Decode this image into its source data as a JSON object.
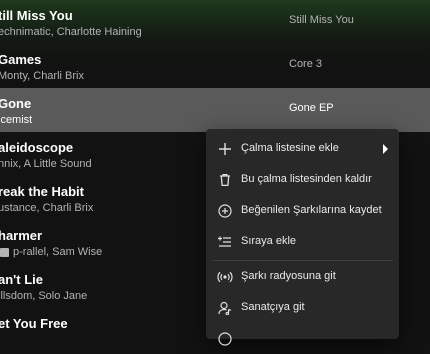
{
  "tracks": [
    {
      "title": "till Miss You",
      "artists": "echnimatic, Charlotte Haining",
      "album": "Still Miss You",
      "explicit": false,
      "selected": false
    },
    {
      "title": "Games",
      "artists": "Monty, Charli Brix",
      "album": "Core 3",
      "explicit": false,
      "selected": false
    },
    {
      "title": "Gone",
      "artists": "lcemist",
      "album": "Gone EP",
      "explicit": false,
      "selected": true
    },
    {
      "title": "aleidoscope",
      "artists": "nnix, A Little Sound",
      "album": "",
      "explicit": false,
      "selected": false
    },
    {
      "title": "reak the Habit",
      "artists": "ustance, Charli Brix",
      "album": "",
      "explicit": false,
      "selected": false
    },
    {
      "title": "harmer",
      "artists": "p-rallel, Sam Wise",
      "album": "",
      "explicit": true,
      "selected": false
    },
    {
      "title": "an't Lie",
      "artists": "illsdom, Solo Jane",
      "album": "",
      "explicit": false,
      "selected": false
    },
    {
      "title": "et You Free",
      "artists": "",
      "album": "",
      "explicit": false,
      "selected": false
    }
  ],
  "context_menu": {
    "items": [
      {
        "label": "Çalma listesine ekle",
        "icon": "plus-icon",
        "has_submenu": true
      },
      {
        "label": "Bu çalma listesinden kaldır",
        "icon": "trash-icon",
        "has_submenu": false
      },
      {
        "label": "Beğenilen Şarkılarına kaydet",
        "icon": "add-circle-icon",
        "has_submenu": false
      },
      {
        "label": "Sıraya ekle",
        "icon": "queue-icon",
        "has_submenu": false
      },
      {
        "label": "Şarkı radyosuna git",
        "icon": "radio-icon",
        "has_submenu": false
      },
      {
        "label": "Sanatçıya git",
        "icon": "artist-icon",
        "has_submenu": false
      }
    ]
  },
  "colors": {
    "background": "#121212",
    "header_gradient": "#1f3a1c",
    "selected_row": "#5a5a5a",
    "menu_background": "#282828",
    "text_primary": "#ffffff",
    "text_secondary": "#b3b3b3"
  }
}
